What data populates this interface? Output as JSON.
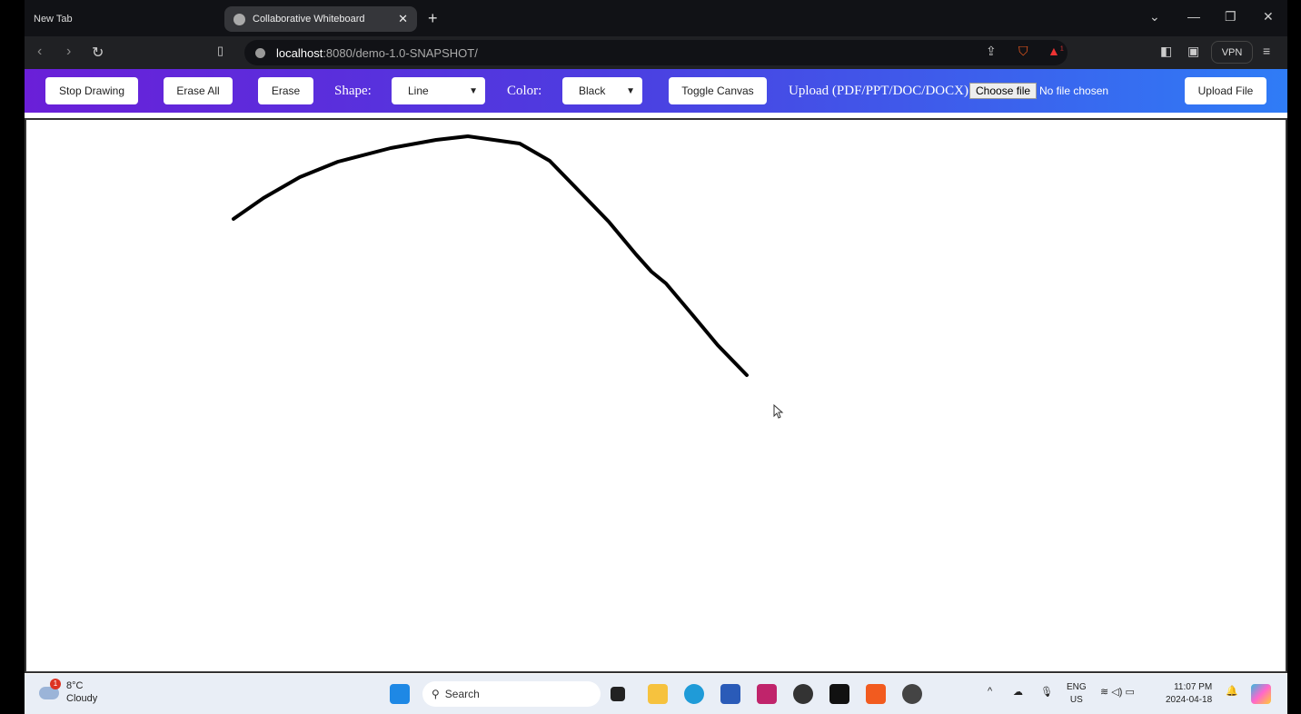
{
  "browser": {
    "tabs": [
      {
        "label": "New Tab"
      },
      {
        "label": "Collaborative Whiteboard"
      }
    ],
    "url_host": "localhost",
    "url_path": ":8080/demo-1.0-SNAPSHOT/",
    "vpn_label": "VPN",
    "alert_count": "1"
  },
  "toolbar": {
    "stop_drawing": "Stop Drawing",
    "erase_all": "Erase All",
    "erase": "Erase",
    "shape_label": "Shape:",
    "shape_value": "Line",
    "color_label": "Color:",
    "color_value": "Black",
    "toggle_canvas": "Toggle Canvas",
    "upload_label": "Upload (PDF/PPT/DOC/DOCX):",
    "choose_file": "Choose file",
    "no_file": "No file chosen",
    "upload_file": "Upload File"
  },
  "taskbar": {
    "weather_temp": "8°C",
    "weather_desc": "Cloudy",
    "weather_badge": "1",
    "search": "Search",
    "lang": "ENG",
    "region": "US",
    "time": "11:07 PM",
    "date": "2024-04-18"
  },
  "colors": {
    "stroke": "#000000"
  }
}
